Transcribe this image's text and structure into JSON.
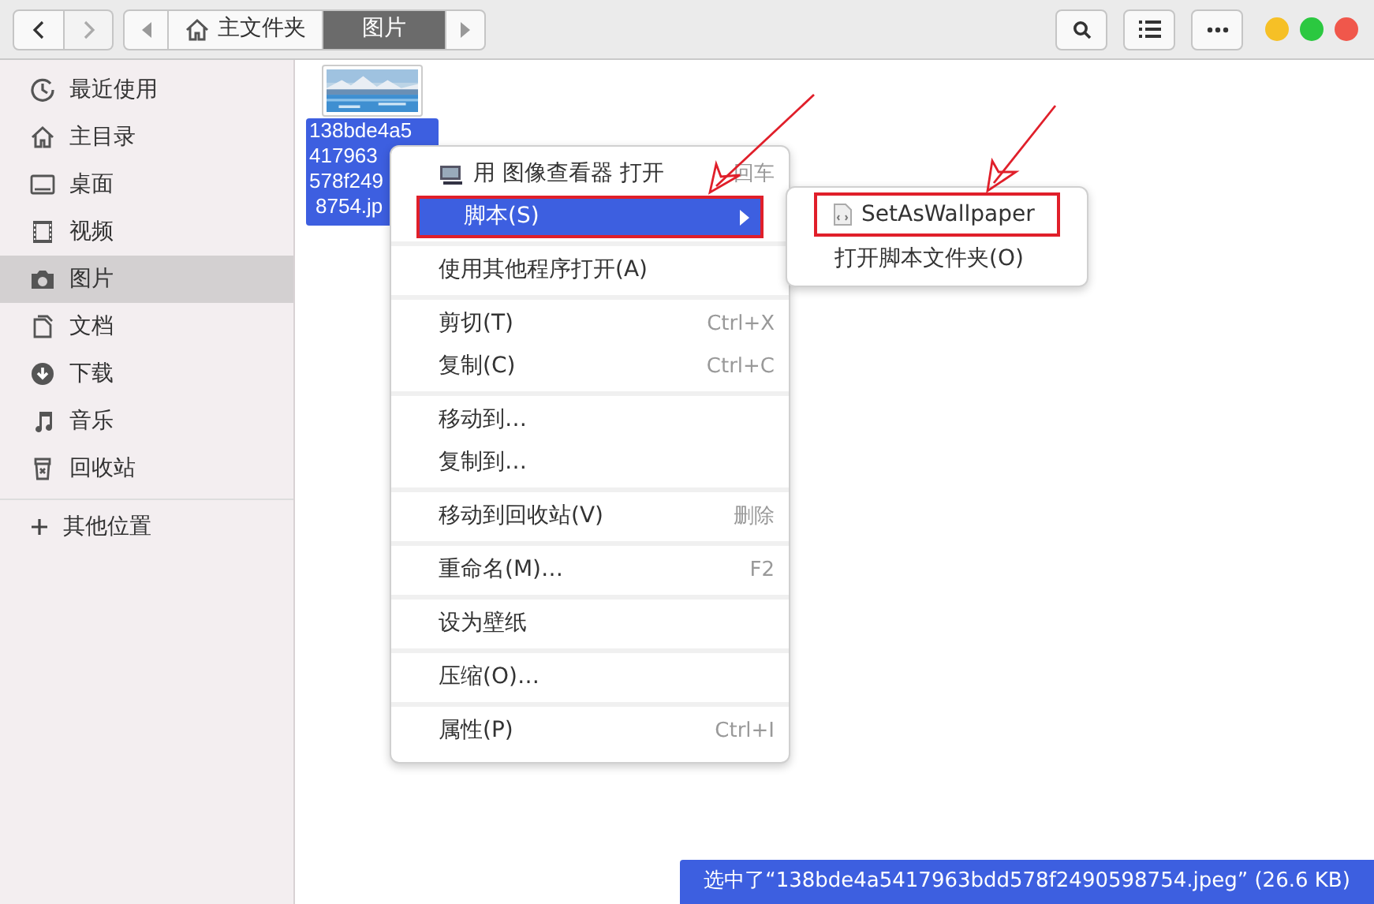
{
  "path_bar": [
    {
      "label": "主文件夹",
      "kind": "home",
      "selected": false
    },
    {
      "label": "图片",
      "kind": "folder",
      "selected": true
    }
  ],
  "sidebar": {
    "items": [
      {
        "label": "最近使用",
        "kind": "recent",
        "selected": false
      },
      {
        "label": "主目录",
        "kind": "home",
        "selected": false
      },
      {
        "label": "桌面",
        "kind": "desktop",
        "selected": false
      },
      {
        "label": "视频",
        "kind": "video",
        "selected": false
      },
      {
        "label": "图片",
        "kind": "pictures",
        "selected": true
      },
      {
        "label": "文档",
        "kind": "documents",
        "selected": false
      },
      {
        "label": "下载",
        "kind": "downloads",
        "selected": false
      },
      {
        "label": "音乐",
        "kind": "music",
        "selected": false
      },
      {
        "label": "回收站",
        "kind": "trash",
        "selected": false
      }
    ],
    "other": {
      "label": "其他位置"
    }
  },
  "file": {
    "kind": "picture",
    "name_lines": [
      "138bde4a5",
      "417963",
      "578f249",
      "8754.jp"
    ],
    "selected": true
  },
  "context_menu": {
    "groups": [
      [
        {
          "label": "用 图像查看器 打开",
          "shortcut": "回车",
          "has_icon": true,
          "has_submenu": false,
          "selected": false,
          "annotated": false
        },
        {
          "label": "脚本(S)",
          "has_icon": false,
          "has_submenu": true,
          "selected": true,
          "annotated": true
        }
      ],
      [
        {
          "label": "使用其他程序打开(A)",
          "has_icon": false,
          "has_submenu": false,
          "selected": false,
          "annotated": false
        }
      ],
      [
        {
          "label": "剪切(T)",
          "shortcut": "Ctrl+X",
          "has_icon": false,
          "has_submenu": false,
          "selected": false,
          "annotated": false
        },
        {
          "label": "复制(C)",
          "shortcut": "Ctrl+C",
          "has_icon": false,
          "has_submenu": false,
          "selected": false,
          "annotated": false
        }
      ],
      [
        {
          "label": "移动到…",
          "has_icon": false,
          "has_submenu": false,
          "selected": false,
          "annotated": false
        },
        {
          "label": "复制到…",
          "has_icon": false,
          "has_submenu": false,
          "selected": false,
          "annotated": false
        }
      ],
      [
        {
          "label": "移动到回收站(V)",
          "shortcut": "删除",
          "has_icon": false,
          "has_submenu": false,
          "selected": false,
          "annotated": false
        }
      ],
      [
        {
          "label": "重命名(M)…",
          "shortcut": "F2",
          "has_icon": false,
          "has_submenu": false,
          "selected": false,
          "annotated": false
        }
      ],
      [
        {
          "label": "设为壁纸",
          "has_icon": false,
          "has_submenu": false,
          "selected": false,
          "annotated": false
        }
      ],
      [
        {
          "label": "压缩(O)…",
          "has_icon": false,
          "has_submenu": false,
          "selected": false,
          "annotated": false
        }
      ],
      [
        {
          "label": "属性(P)",
          "shortcut": "Ctrl+I",
          "has_icon": false,
          "has_submenu": false,
          "selected": false,
          "annotated": false
        }
      ]
    ]
  },
  "submenu": {
    "items": [
      {
        "label": "SetAsWallpaper",
        "has_icon": true,
        "annotated": true
      },
      {
        "label": "打开脚本文件夹(O)",
        "has_icon": false,
        "annotated": false
      }
    ]
  },
  "status_bar": {
    "text": "选中了“138bde4a5417963bdd578f2490598754.jpeg” (26.6 KB)"
  }
}
